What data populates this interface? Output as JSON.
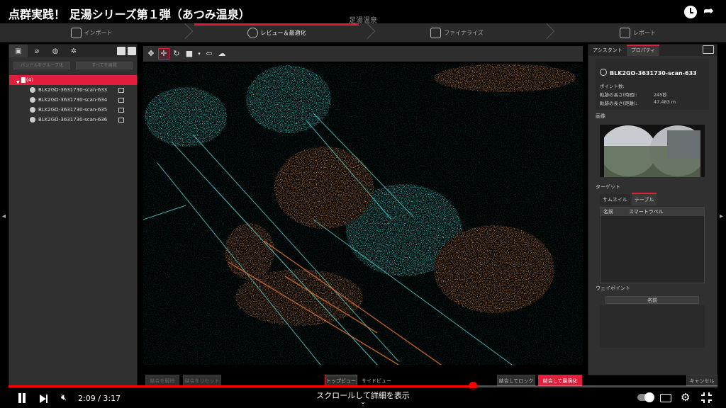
{
  "video": {
    "title": "点群実践！ 足湯シリーズ第１弾（あつみ温泉）",
    "time": "2:09 / 3:17",
    "progress_fraction": 0.655,
    "scroll_hint": "スクロールして詳細を表示"
  },
  "app": {
    "caption": "足湯温泉",
    "steps": [
      {
        "label": "インポート",
        "icon": "import-icon"
      },
      {
        "label": "レビュー＆最適化",
        "icon": "review-optimize-icon"
      },
      {
        "label": "ファイナライズ",
        "icon": "finalize-icon"
      },
      {
        "label": "レポート",
        "icon": "report-icon"
      }
    ],
    "active_step": 1,
    "accent": "#e31e3c"
  },
  "left_panel": {
    "buttons": [
      "パンドルをグループ化",
      "すべてを展開"
    ],
    "group_label": "(4)",
    "scans": [
      "BLK2GO-3631730-scan-633",
      "BLK2GO-3631730-scan-634",
      "BLK2GO-3631730-scan-635",
      "BLK2GO-3631730-scan-636"
    ]
  },
  "right_panel": {
    "tabs": [
      "アシスタント",
      "プロパティ"
    ],
    "scan_name": "BLK2GO-3631730-scan-633",
    "props": [
      {
        "label": "ポイント数:",
        "value": ""
      },
      {
        "label": "軌跡の長さ(時間):",
        "value": "245秒"
      },
      {
        "label": "軌跡の長さ(距離):",
        "value": "47.483 m"
      }
    ],
    "image_label": "画像",
    "target_label": "ターゲット",
    "target_tabs": [
      "サムネイル",
      "テーブル"
    ],
    "table_headers": [
      "名前",
      "スマートラベル"
    ],
    "waypoint_label": "ウェイポイント",
    "waypoint_button": "名前"
  },
  "action_bar": {
    "disabled_left": [
      "結合を解除",
      "結合をリセット"
    ],
    "views": [
      "トップビュー",
      "サイドビュー"
    ],
    "lock_button": "結合してロック",
    "optimize_button": "結合して最適化",
    "cancel_button": "キャンセル"
  }
}
